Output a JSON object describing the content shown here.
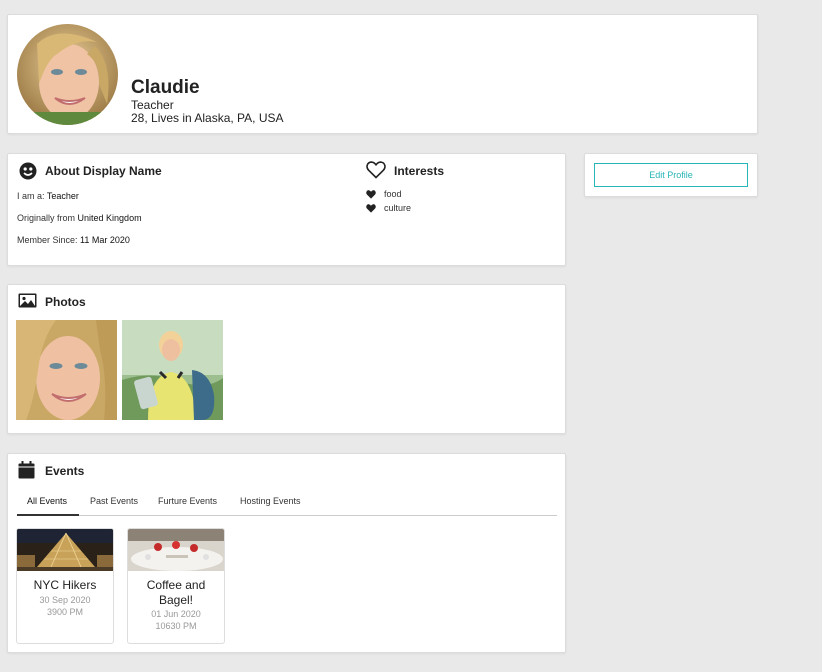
{
  "profile": {
    "name": "Claudie",
    "occupation": "Teacher",
    "location": "28, Lives in Alaska, PA, USA"
  },
  "about": {
    "title": "About Display Name",
    "i_am_label": "I am a:",
    "i_am_value": "Teacher",
    "from_label": "Originally from",
    "from_value": "United Kingdom",
    "member_label": "Member Since:",
    "member_value": "11 Mar 2020"
  },
  "interests": {
    "title": "Interests",
    "items": [
      "food",
      "culture"
    ]
  },
  "edit_profile": {
    "label": "Edit Profile"
  },
  "photos": {
    "title": "Photos"
  },
  "events": {
    "title": "Events",
    "tabs": [
      "All Events",
      "Past Events",
      "Furture Events",
      "Hosting Events"
    ],
    "active_tab": "All Events",
    "items": [
      {
        "title_line1": "NYC Hikers",
        "title_line2": "",
        "date": "30 Sep 2020",
        "time": "3900 PM"
      },
      {
        "title_line1": "Coffee and",
        "title_line2": "Bagel!",
        "date": "01 Jun 2020",
        "time": "10630 PM"
      }
    ]
  },
  "colors": {
    "accent": "#27b5b5",
    "background": "#e9e9e9"
  },
  "icons": [
    "smiley-icon",
    "heart-outline-icon",
    "heart-icon",
    "image-icon",
    "calendar-icon"
  ]
}
